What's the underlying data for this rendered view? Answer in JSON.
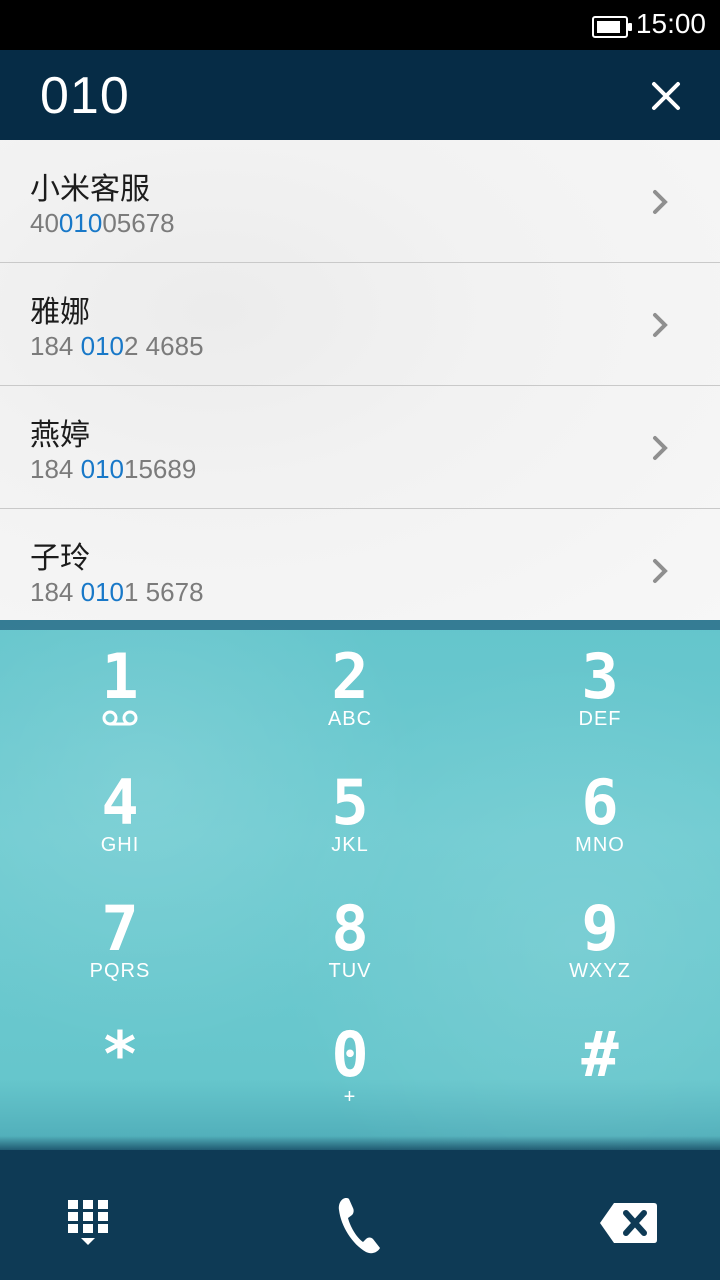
{
  "status_bar": {
    "time": "15:00",
    "battery_level": 0.9
  },
  "header": {
    "digits": "010"
  },
  "results": [
    {
      "name": "小米客服",
      "number_parts": [
        "40",
        "010",
        "05678"
      ]
    },
    {
      "name": "雅娜",
      "number_parts": [
        "184 ",
        "010",
        "2 4685"
      ]
    },
    {
      "name": "燕婷",
      "number_parts": [
        "184 ",
        "010",
        "15689"
      ]
    },
    {
      "name": "子玲",
      "number_parts": [
        "184 ",
        "010",
        "1 5678"
      ]
    }
  ],
  "keypad": [
    {
      "digit": "1",
      "letters": ""
    },
    {
      "digit": "2",
      "letters": "ABC"
    },
    {
      "digit": "3",
      "letters": "DEF"
    },
    {
      "digit": "4",
      "letters": "GHI"
    },
    {
      "digit": "5",
      "letters": "JKL"
    },
    {
      "digit": "6",
      "letters": "MNO"
    },
    {
      "digit": "7",
      "letters": "PQRS"
    },
    {
      "digit": "8",
      "letters": "TUV"
    },
    {
      "digit": "9",
      "letters": "WXYZ"
    },
    {
      "digit": "*",
      "letters": ""
    },
    {
      "digit": "0",
      "letters": "+"
    },
    {
      "digit": "#",
      "letters": ""
    }
  ],
  "icons": {
    "close": "close-icon",
    "chevron": "chevron-right-icon",
    "voicemail": "voicemail-icon",
    "grid": "dialpad-toggle-icon",
    "call": "phone-icon",
    "delete": "backspace-icon"
  },
  "colors": {
    "highlight": "#1878c8",
    "header": "#062c46",
    "pad": "#64c5cc"
  }
}
